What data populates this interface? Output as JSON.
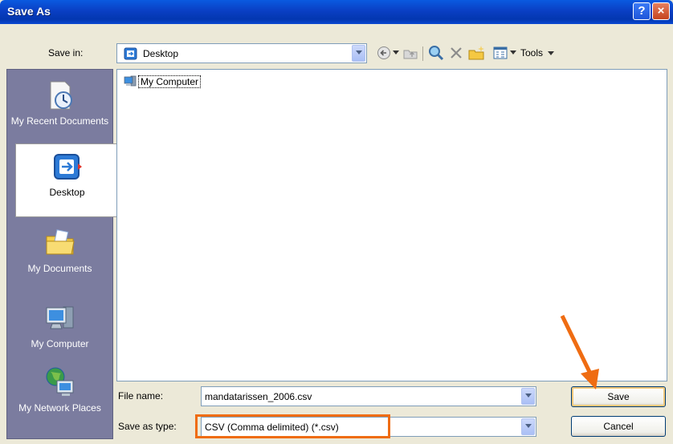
{
  "window": {
    "title": "Save As"
  },
  "titlebar": {
    "help_glyph": "?",
    "close_glyph": "×"
  },
  "save_in": {
    "label": "Save in:",
    "value": "Desktop"
  },
  "toolbar": {
    "tools_label": "Tools"
  },
  "places": [
    {
      "label": "My Recent Documents",
      "icon": "recent-documents-icon"
    },
    {
      "label": "Desktop",
      "icon": "desktop-icon",
      "selected": true
    },
    {
      "label": "My Documents",
      "icon": "my-documents-icon"
    },
    {
      "label": "My Computer",
      "icon": "my-computer-icon"
    },
    {
      "label": "My Network Places",
      "icon": "network-places-icon"
    }
  ],
  "file_list": {
    "items": [
      {
        "label": "My Computer",
        "icon": "my-computer-icon"
      }
    ]
  },
  "file_name": {
    "label": "File name:",
    "value": "mandatarissen_2006.csv"
  },
  "save_as_type": {
    "label": "Save as type:",
    "value": "CSV (Comma delimited) (*.csv)"
  },
  "buttons": {
    "save": "Save",
    "cancel": "Cancel"
  },
  "colors": {
    "highlight": "#ef6c12",
    "titlebar": "#0a3fc4",
    "places_bar": "#7b7c9f"
  }
}
